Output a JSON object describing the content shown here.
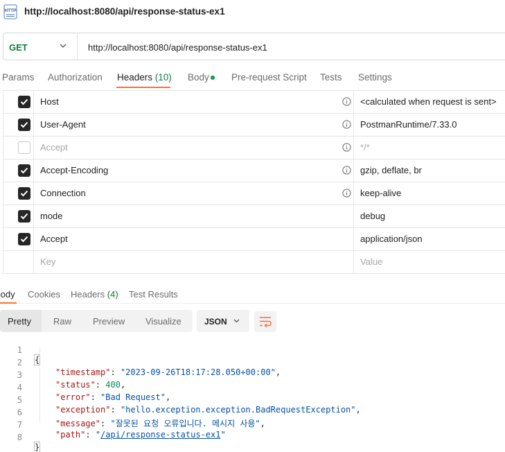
{
  "window": {
    "title": "http://localhost:8080/api/response-status-ex1",
    "icon": "http-icon"
  },
  "request": {
    "method": "GET",
    "url": "http://localhost:8080/api/response-status-ex1"
  },
  "request_tabs": [
    {
      "label": "Params"
    },
    {
      "label": "Authorization"
    },
    {
      "label": "Headers",
      "count": "(10)",
      "active": true
    },
    {
      "label": "Body",
      "dot": true
    },
    {
      "label": "Pre-request Script"
    },
    {
      "label": "Tests"
    },
    {
      "label": "Settings"
    }
  ],
  "headers": [
    {
      "key": "Host",
      "value": "<calculated when request is sent>",
      "checked": true,
      "info": true
    },
    {
      "key": "User-Agent",
      "value": "PostmanRuntime/7.33.0",
      "checked": true,
      "info": true
    },
    {
      "key": "Accept",
      "value": "*/*",
      "checked": false,
      "info": true
    },
    {
      "key": "Accept-Encoding",
      "value": "gzip, deflate, br",
      "checked": true,
      "info": true
    },
    {
      "key": "Connection",
      "value": "keep-alive",
      "checked": true,
      "info": true
    },
    {
      "key": "mode",
      "value": "debug",
      "checked": true,
      "info": false
    },
    {
      "key": "Accept",
      "value": "application/json",
      "checked": true,
      "info": false
    }
  ],
  "new_header": {
    "key_placeholder": "Key",
    "value_placeholder": "Value"
  },
  "response_tabs": [
    {
      "label": "Body",
      "active": true
    },
    {
      "label": "Cookies"
    },
    {
      "label": "Headers",
      "count": "(4)"
    },
    {
      "label": "Test Results"
    }
  ],
  "view_modes": [
    "Pretty",
    "Raw",
    "Preview",
    "Visualize"
  ],
  "active_view": "Pretty",
  "format": "JSON",
  "response_body": {
    "line_numbers": [
      "1",
      "2",
      "3",
      "4",
      "5",
      "6",
      "7",
      "8"
    ],
    "open_brace": "{",
    "close_brace": "}",
    "fields": [
      {
        "key": "\"timestamp\"",
        "value": "\"2023-09-26T18:17:28.050+00:00\"",
        "type": "string",
        "comma": ","
      },
      {
        "key": "\"status\"",
        "value": "400",
        "type": "number",
        "comma": ","
      },
      {
        "key": "\"error\"",
        "value": "\"Bad Request\"",
        "type": "string",
        "comma": ","
      },
      {
        "key": "\"exception\"",
        "value": "\"hello.exception.exception.BadRequestException\"",
        "type": "string",
        "comma": ","
      },
      {
        "key": "\"message\"",
        "value": "\"잘못된 요청 오류입니다. 메시지 사용\"",
        "type": "string",
        "comma": ","
      },
      {
        "key": "\"path\"",
        "value_quote": "\"",
        "value": "/api/response-status-ex1",
        "type": "link",
        "comma": ""
      }
    ]
  }
}
